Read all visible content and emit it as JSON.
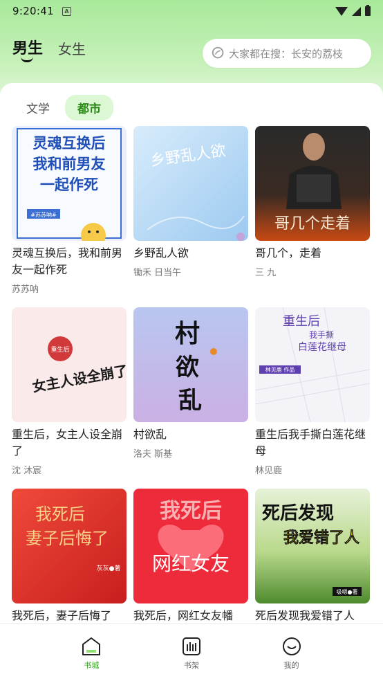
{
  "status": {
    "time": "9:20:41",
    "notif": "A"
  },
  "header": {
    "gender_tabs": [
      "男生",
      "女生"
    ],
    "search_placeholder": "大家都在搜：长安的荔枝"
  },
  "categories": [
    "文学",
    "都市"
  ],
  "books": [
    {
      "title": "灵魂互换后，我和前男友一起作死",
      "author": "苏苏呐",
      "cover_text": [
        "灵魂互换后",
        "我和前男友",
        "一起作死"
      ],
      "cover_tag": "#苏苏呐#"
    },
    {
      "title": "乡野乱人欲",
      "author": "锄禾 日当午",
      "cover_text": [
        "乡野乱人欲"
      ]
    },
    {
      "title": "哥几个，走着",
      "author": "三 九",
      "cover_text": [
        "哥几个走着"
      ]
    },
    {
      "title": "重生后，女主人设全崩了",
      "author": "沈 沐宸",
      "cover_text": [
        "女主人设全崩了"
      ],
      "cover_tag": "重生后"
    },
    {
      "title": "村欲乱",
      "author": "洛夫 斯基",
      "cover_text": [
        "村",
        "欲",
        "乱"
      ]
    },
    {
      "title": "重生后我手撕白莲花继母",
      "author": "林见鹿",
      "cover_text": [
        "重生后",
        "我手撕",
        "白莲花继母"
      ],
      "cover_tag": "林见鹿 作品"
    },
    {
      "title": "我死后，妻子后悔了",
      "author": "",
      "cover_text": [
        "我死后",
        "妻子后悔了"
      ],
      "cover_tag": "灰灰●著"
    },
    {
      "title": "我死后，网红女友幡",
      "author": "",
      "cover_text": [
        "我死后",
        "网红女友"
      ]
    },
    {
      "title": "死后发现我爱错了人",
      "author": "",
      "cover_text": [
        "死后发现",
        "我爱错了人"
      ],
      "cover_tag": "吸嗯●著"
    }
  ],
  "nav": [
    "书城",
    "书架",
    "我的"
  ],
  "colors": {
    "accent": "#34a31f",
    "tab_active_bg": "#dcf7d3"
  }
}
